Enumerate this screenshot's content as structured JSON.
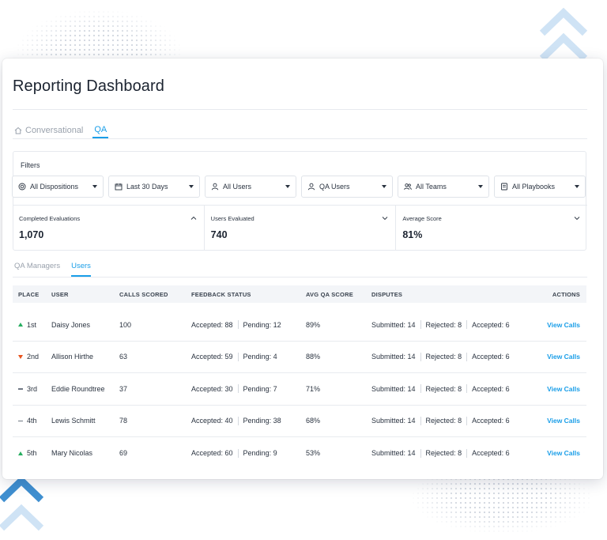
{
  "page": {
    "title": "Reporting Dashboard",
    "accent_color": "#1a9ee8"
  },
  "tabs": [
    {
      "label": "Conversational",
      "icon": "home-icon",
      "active": false
    },
    {
      "label": "QA",
      "active": true
    }
  ],
  "filters": {
    "label": "Filters",
    "dropdowns": [
      {
        "label": "All Dispositions",
        "icon": "target-icon"
      },
      {
        "label": "Last 30 Days",
        "icon": "calendar-icon"
      },
      {
        "label": "All Users",
        "icon": "user-icon"
      },
      {
        "label": "QA Users",
        "icon": "user-icon"
      },
      {
        "label": "All Teams",
        "icon": "team-icon"
      },
      {
        "label": "All Playbooks",
        "icon": "playbook-icon"
      }
    ]
  },
  "metrics": [
    {
      "label": "Completed Evaluations",
      "value": "1,070",
      "expanded": true
    },
    {
      "label": "Users Evaluated",
      "value": "740",
      "expanded": false
    },
    {
      "label": "Average Score",
      "value": "81%",
      "expanded": false
    }
  ],
  "subtabs": [
    {
      "label": "QA Managers",
      "active": false
    },
    {
      "label": "Users",
      "active": true
    }
  ],
  "table": {
    "headers": {
      "place": "PLACE",
      "user": "USER",
      "calls": "CALLS SCORED",
      "feedback": "FEEDBACK STATUS",
      "avg": "AVG QA SCORE",
      "disputes": "DISPUTES",
      "actions": "ACTIONS"
    },
    "rows": [
      {
        "trend": "up",
        "place": "1st",
        "user": "Daisy Jones",
        "calls": "100",
        "accepted": "Accepted: 88",
        "pending": "Pending: 12",
        "avg": "89%",
        "submitted": "Submitted: 14",
        "rejected": "Rejected: 8",
        "disp_accepted": "Accepted: 6",
        "action": "View Calls"
      },
      {
        "trend": "down",
        "place": "2nd",
        "user": "Allison Hirthe",
        "calls": "63",
        "accepted": "Accepted: 59",
        "pending": "Pending: 4",
        "avg": "88%",
        "submitted": "Submitted: 14",
        "rejected": "Rejected: 8",
        "disp_accepted": "Accepted: 6",
        "action": "View Calls"
      },
      {
        "trend": "flat",
        "place": "3rd",
        "user": "Eddie Roundtree",
        "calls": "37",
        "accepted": "Accepted: 30",
        "pending": "Pending: 7",
        "avg": "71%",
        "submitted": "Submitted: 14",
        "rejected": "Rejected: 8",
        "disp_accepted": "Accepted: 6",
        "action": "View Calls"
      },
      {
        "trend": "flat",
        "place": "4th",
        "user": "Lewis Schmitt",
        "calls": "78",
        "accepted": "Accepted: 40",
        "pending": "Pending: 38",
        "avg": "68%",
        "submitted": "Submitted: 14",
        "rejected": "Rejected: 8",
        "disp_accepted": "Accepted: 6",
        "action": "View Calls"
      },
      {
        "trend": "up",
        "place": "5th",
        "user": "Mary Nicolas",
        "calls": "69",
        "accepted": "Accepted: 60",
        "pending": "Pending: 9",
        "avg": "53%",
        "submitted": "Submitted: 14",
        "rejected": "Rejected: 8",
        "disp_accepted": "Accepted: 6",
        "action": "View Calls"
      }
    ]
  },
  "colors": {
    "trend_up": "#27ae60",
    "trend_down": "#e8541e",
    "chevron_light": "#cfe3f5",
    "chevron_dark": "#3f8fd0"
  }
}
